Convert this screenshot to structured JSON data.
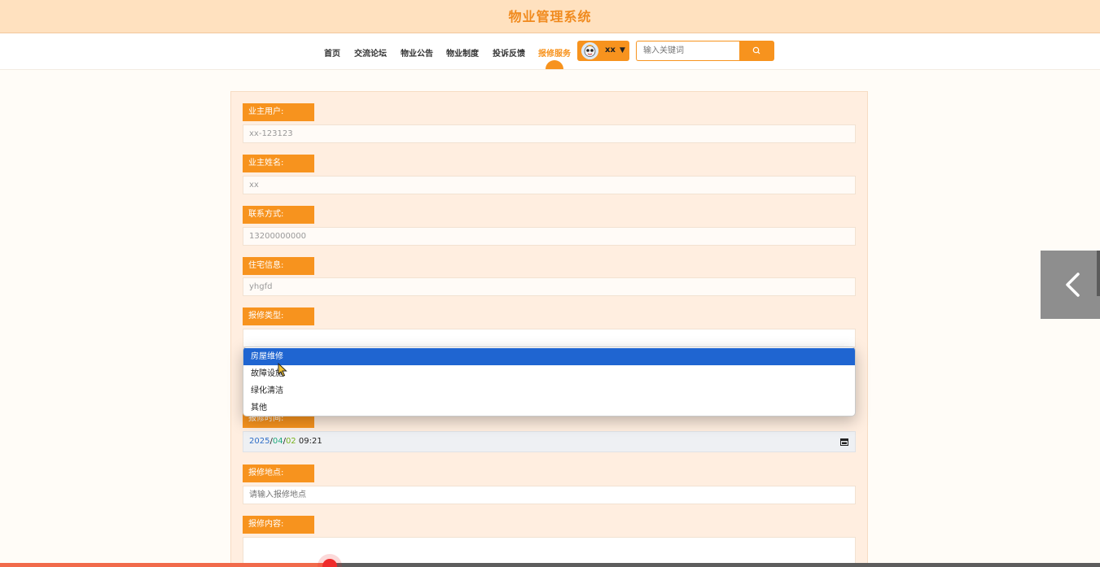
{
  "header": {
    "title": "物业管理系统"
  },
  "nav": {
    "items": [
      "首页",
      "交流论坛",
      "物业公告",
      "物业制度",
      "投诉反馈",
      "报修服务"
    ],
    "active": "报修服务"
  },
  "user": {
    "name": "xx"
  },
  "search": {
    "placeholder": "输入关键词"
  },
  "form": {
    "owner_user_label": "业主用户:",
    "owner_user_value": "xx-123123",
    "owner_name_label": "业主姓名:",
    "owner_name_value": "xx",
    "contact_label": "联系方式:",
    "contact_value": "13200000000",
    "residence_label": "住宅信息:",
    "residence_value": "yhgfd",
    "repair_type_label": "报修类型:",
    "repair_time_label": "报修时间:",
    "repair_time_value": {
      "year": "2025",
      "month": "04",
      "day": "02",
      "time": "09:21"
    },
    "repair_location_label": "报修地点:",
    "repair_location_placeholder": "请输入报修地点",
    "repair_content_label": "报修内容:"
  },
  "repair_type_options": [
    "房屋维修",
    "故障设施",
    "绿化清洁",
    "其他"
  ],
  "repair_type_selected_index": 0,
  "video": {
    "progress": 0.3
  },
  "colors": {
    "accent": "#f7931e",
    "header_bg": "#ffe1bf",
    "selected": "#1f65d1"
  }
}
